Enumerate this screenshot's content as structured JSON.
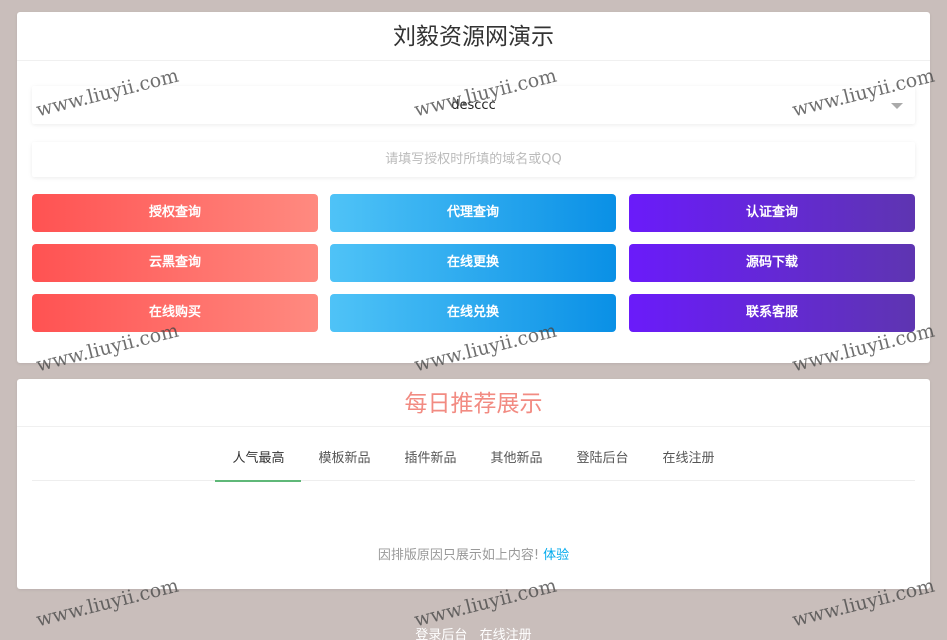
{
  "query_card": {
    "title": "刘毅资源网演示",
    "select_value": "desccc",
    "input_placeholder": "请填写授权时所填的域名或QQ",
    "buttons": [
      {
        "label": "授权查询",
        "color": "red"
      },
      {
        "label": "代理查询",
        "color": "blue"
      },
      {
        "label": "认证查询",
        "color": "purple"
      },
      {
        "label": "云黑查询",
        "color": "red"
      },
      {
        "label": "在线更换",
        "color": "blue"
      },
      {
        "label": "源码下载",
        "color": "purple"
      },
      {
        "label": "在线购买",
        "color": "red"
      },
      {
        "label": "在线兑换",
        "color": "blue"
      },
      {
        "label": "联系客服",
        "color": "purple"
      }
    ]
  },
  "recommend_card": {
    "title": "每日推荐展示",
    "tabs": [
      "人气最高",
      "模板新品",
      "插件新品",
      "其他新品",
      "登陆后台",
      "在线注册"
    ],
    "active_tab": 0,
    "notice_text": "因排版原因只展示如上内容!",
    "notice_link": "体验"
  },
  "footer": {
    "links": [
      "登录后台",
      "在线注册"
    ]
  },
  "watermark": "www.liuyii.com",
  "colors": {
    "background": "#c9bebb",
    "title_pink": "#f28b82",
    "tab_active_underline": "#5fb878",
    "link_blue": "#01aaed"
  }
}
